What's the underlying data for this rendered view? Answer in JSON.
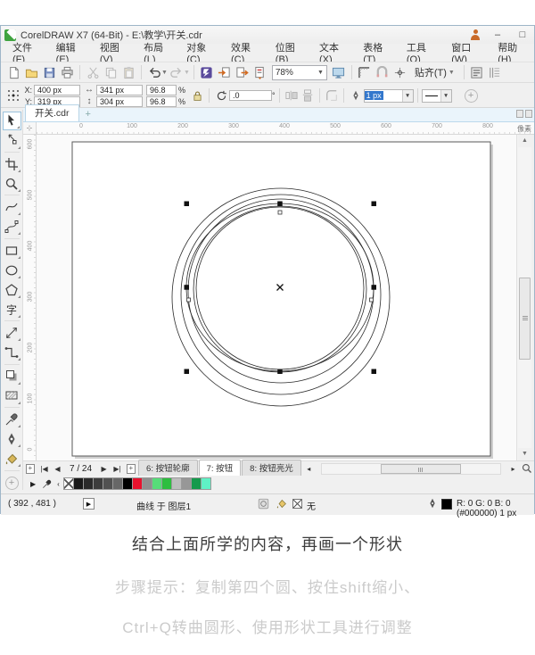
{
  "window": {
    "title": "CorelDRAW X7 (64-Bit) - E:\\教学\\开关.cdr",
    "minimize": "–",
    "maximize": "□"
  },
  "menu": {
    "items": [
      "文件(F)",
      "编辑(E)",
      "视图(V)",
      "布局(L)",
      "对象(C)",
      "效果(C)",
      "位图(B)",
      "文本(X)",
      "表格(T)",
      "工具(O)",
      "窗口(W)",
      "帮助(H)"
    ]
  },
  "toolbar": {
    "zoom_level": "78%",
    "snap_label": "贴齐(T)"
  },
  "property_bar": {
    "x_label": "X:",
    "x_value": "400 px",
    "y_label": "Y:",
    "y_value": "319 px",
    "width_value": "341 px",
    "height_value": "304 px",
    "scale_x": "96.8",
    "scale_y": "96.8",
    "percent_x": "%",
    "percent_y": "%",
    "rotation_value": ".0",
    "degree_symbol": "°",
    "outline_width": "1 px"
  },
  "document_tab": {
    "name": "开关.cdr",
    "new_tab": "+"
  },
  "rulers": {
    "h_ticks": [
      "0",
      "100",
      "200",
      "300",
      "400",
      "500",
      "600",
      "700",
      "800"
    ],
    "v_ticks": [
      "600",
      "500",
      "400",
      "300",
      "200",
      "100",
      "0"
    ],
    "unit": "像素"
  },
  "toolbox": {
    "tools": [
      "pick",
      "shape",
      "crop",
      "zoom",
      "freehand",
      "bezier",
      "rectangle",
      "ellipse",
      "polygon",
      "text",
      "dimension",
      "connector",
      "drop-shadow",
      "transparency",
      "eyedropper",
      "outline-pen",
      "smart-fill"
    ]
  },
  "pages": {
    "position": "7 / 24",
    "tabs": [
      "6: 按钮轮廓",
      "7: 按钮",
      "8: 按钮亮光"
    ],
    "active_index": 1
  },
  "palette": {
    "colors": [
      "#1a1a1a",
      "#2b2b2b",
      "#3d3d3d",
      "#515151",
      "#676767",
      "#000000",
      "#e8112d",
      "#8f8f8f",
      "#57dd79",
      "#2dbe3f",
      "#bdbdbd",
      "#979797",
      "#149a4c",
      "#5ff2c5"
    ]
  },
  "status": {
    "coords": "( 392 , 481 )",
    "object_info": "曲线 于 图层1",
    "fill_none": "无",
    "outline_info": "R: 0 G: 0 B: 0 (#000000) 1 px"
  },
  "caption": {
    "line1": "结合上面所学的内容，再画一个形状",
    "line2": "步骤提示：复制第四个圆、按住shift缩小、",
    "line3": "Ctrl+Q转曲圆形、使用形状工具进行调整"
  }
}
